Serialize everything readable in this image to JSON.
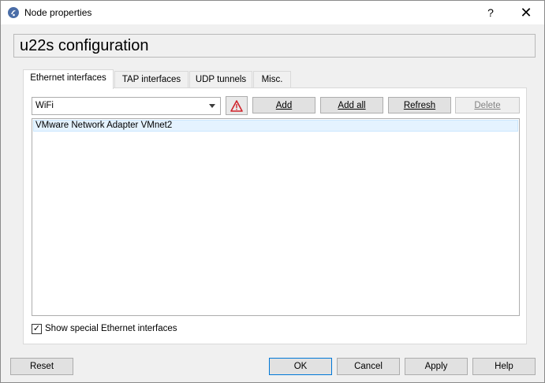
{
  "window": {
    "title": "Node properties",
    "help_symbol": "?",
    "close_symbol": "✕"
  },
  "header": {
    "title": "u22s configuration"
  },
  "tabs": [
    {
      "label": "Ethernet interfaces",
      "active": true
    },
    {
      "label": "TAP interfaces",
      "active": false
    },
    {
      "label": "UDP tunnels",
      "active": false
    },
    {
      "label": "Misc.",
      "active": false
    }
  ],
  "ethernet": {
    "combo_value": "WiFi",
    "buttons": {
      "add": "Add",
      "add_all": "Add all",
      "refresh": "Refresh",
      "delete": "Delete"
    },
    "interfaces": [
      "VMware Network Adapter VMnet2"
    ],
    "show_special_label": "Show special Ethernet interfaces",
    "show_special_checked": true,
    "check_mark": "✓"
  },
  "footer": {
    "reset": "Reset",
    "ok": "OK",
    "cancel": "Cancel",
    "apply": "Apply",
    "help": "Help"
  },
  "colors": {
    "warning_red": "#d0232b",
    "selection_bg": "#e5f3ff",
    "default_border": "#0078d7"
  }
}
